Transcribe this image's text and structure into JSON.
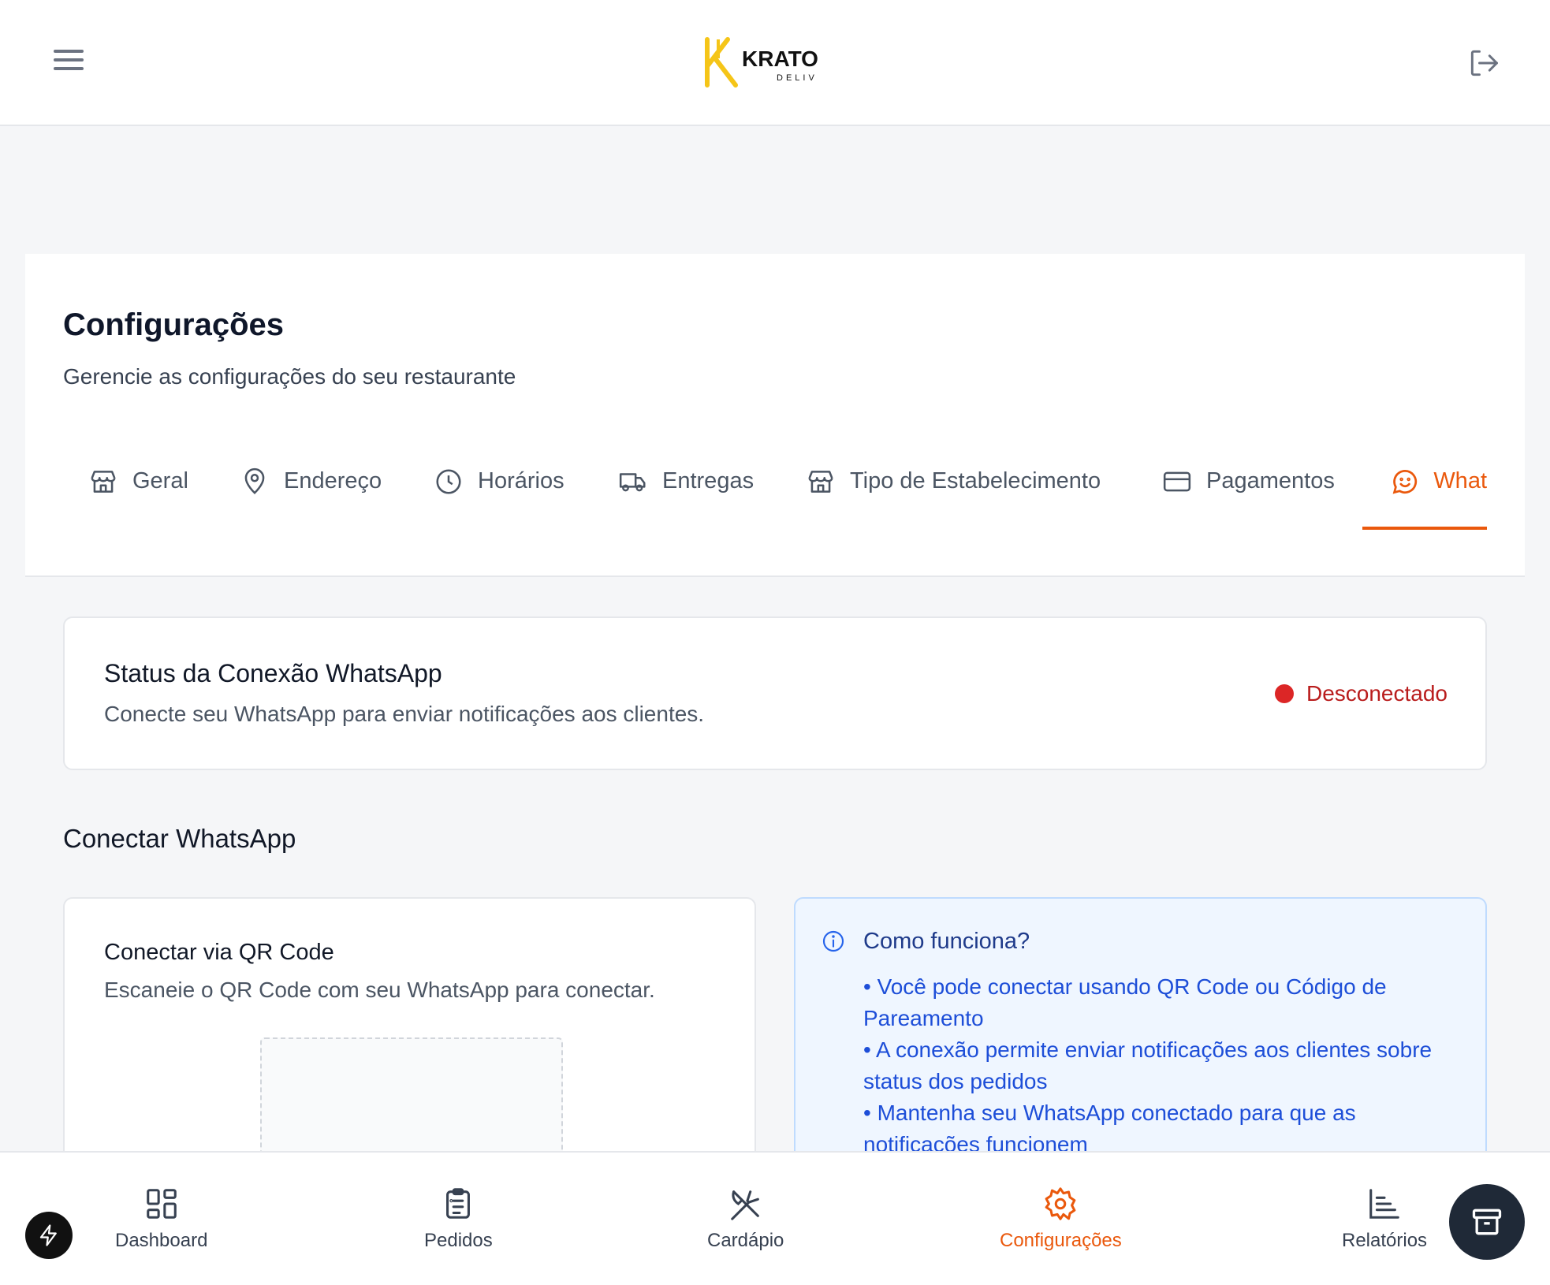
{
  "header": {
    "brand": "KRATO",
    "brand_sub": "DELIV",
    "menu_icon": "hamburger-icon",
    "logout_icon": "logout-icon"
  },
  "page": {
    "title": "Configurações",
    "subtitle": "Gerencie as configurações do seu restaurante"
  },
  "tabs": [
    {
      "label": "Geral",
      "icon": "store-icon"
    },
    {
      "label": "Endereço",
      "icon": "map-pin-icon"
    },
    {
      "label": "Horários",
      "icon": "clock-icon"
    },
    {
      "label": "Entregas",
      "icon": "truck-icon"
    },
    {
      "label": "Tipo de Estabelecimento",
      "icon": "store-icon"
    },
    {
      "label": "Pagamentos",
      "icon": "credit-card-icon"
    },
    {
      "label": "What",
      "icon": "smile-chat-icon",
      "active": true
    }
  ],
  "status": {
    "title": "Status da Conexão WhatsApp",
    "description": "Conecte seu WhatsApp para enviar notificações aos clientes.",
    "badge": "Desconectado"
  },
  "connect": {
    "section_title": "Conectar WhatsApp",
    "qr_title": "Conectar via QR Code",
    "qr_description": "Escaneie o QR Code com seu WhatsApp para conectar."
  },
  "info": {
    "title": "Como funciona?",
    "items": [
      "• Você pode conectar usando QR Code ou Código de Pareamento",
      "• A conexão permite enviar notificações aos clientes sobre status dos pedidos",
      "• Mantenha seu WhatsApp conectado para que as notificações funcionem"
    ]
  },
  "bottom_nav": [
    {
      "label": "Dashboard",
      "icon": "grid-icon"
    },
    {
      "label": "Pedidos",
      "icon": "clipboard-icon"
    },
    {
      "label": "Cardápio",
      "icon": "utensils-crossed-icon"
    },
    {
      "label": "Configurações",
      "icon": "gear-icon",
      "active": true
    },
    {
      "label": "Relatórios",
      "icon": "bar-chart-icon"
    }
  ],
  "colors": {
    "accent": "#ea580c",
    "danger": "#dc2626",
    "info_bg": "#eff6ff",
    "info_text": "#1d4ed8",
    "brand_yellow": "#f5c518"
  }
}
